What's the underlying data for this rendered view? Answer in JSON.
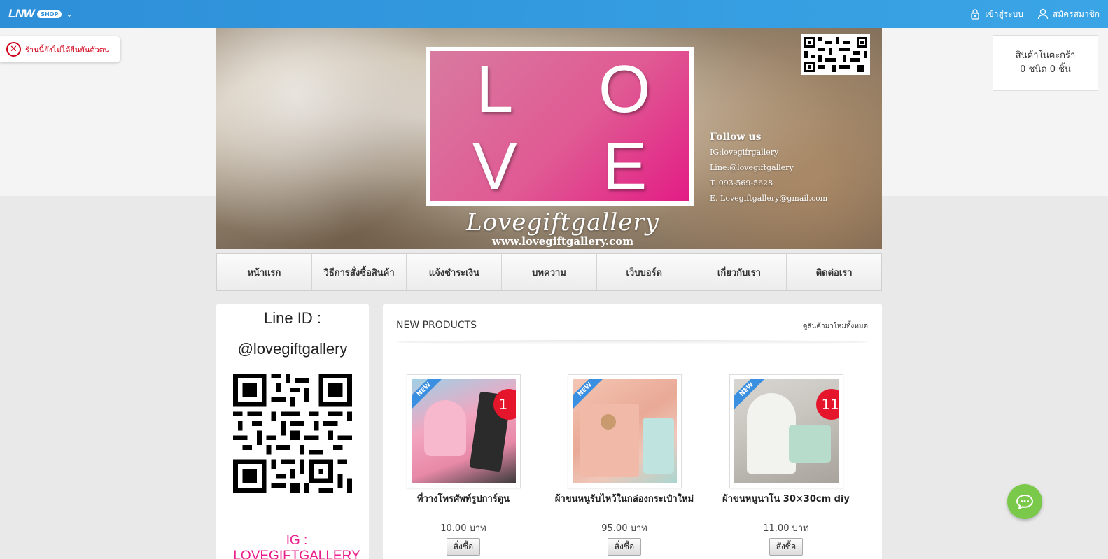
{
  "topbar": {
    "brand": "LNW",
    "brand_badge": "SHOP",
    "login": "เข้าสู่ระบบ",
    "register": "สมัครสมาชิก"
  },
  "alert": {
    "text": "ร้านนี้ยังไม่ได้ยืนยันตัวตน"
  },
  "cart": {
    "title": "สินค้าในตะกร้า",
    "summary": "0 ชนิด 0 ชิ้น"
  },
  "banner": {
    "love_letters": [
      "L",
      "O",
      "V",
      "E"
    ],
    "follow": "Follow us",
    "ig": "IG:lovegifrgallery",
    "line": "Line:@lovegiftgallery",
    "tel": "T. 093-569-5628",
    "email": "E. Lovegiftgallery@gmail.com",
    "script": "Lovegiftgallery",
    "url": "www.lovegiftgallery.com"
  },
  "nav": [
    "หน้าแรก",
    "วิธีการสั่งซื้อสินค้า",
    "แจ้งชำระเงิน",
    "บทความ",
    "เว็บบอร์ด",
    "เกี่ยวกับเรา",
    "ติดต่อเรา"
  ],
  "sidebar": {
    "line_label": "Line ID :",
    "line_id": "@lovegiftgallery",
    "ig": "IG  : LOVEGIFTGALLERY"
  },
  "main": {
    "heading": "NEW PRODUCTS",
    "view_all": "ดูสินค้ามาใหม่ทั้งหมด",
    "badge_new": "NEW",
    "buy_label": "สั่งซื้อ",
    "products": [
      {
        "name": "ที่วางโทรศัพท์รูปการ์ตูน",
        "price": "10.00 บาท",
        "discount": "1"
      },
      {
        "name": "ผ้าขนหนูรับไหว้ในกล่องกระเป๋าใหม่",
        "price": "95.00 บาท",
        "discount": ""
      },
      {
        "name": "ผ้าขนหนูนาโน 30×30cm diy",
        "price": "11.00 บาท",
        "discount": "11-"
      }
    ]
  },
  "colors": {
    "topbar": "#2d8fd8",
    "accent_pink": "#e91e8c",
    "chat": "#7ac94a",
    "alert": "#d0021b"
  }
}
